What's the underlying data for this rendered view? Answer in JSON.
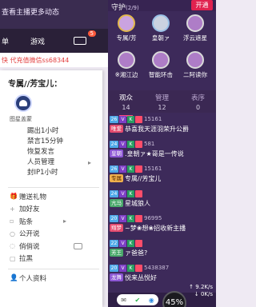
{
  "left_panel": {
    "follow_text": "查看主播更多动态",
    "tabs": [
      "单",
      "游戏"
    ],
    "tab_badge": "5",
    "ticker": "快 代充值微信ss68344"
  },
  "menu": {
    "title": "专属//芳宝儿：",
    "avatar_caption": "图星盖蒙",
    "ops": [
      {
        "label": "踢出1小时",
        "has_arrow": false
      },
      {
        "label": "禁言15分钟",
        "has_arrow": false
      },
      {
        "label": "恢复发言",
        "has_arrow": false
      },
      {
        "label": "人员管理",
        "has_arrow": true
      },
      {
        "label": "封IP1小时",
        "has_arrow": false
      }
    ],
    "items": [
      {
        "icon": "gift-icon",
        "glyph": "🎁",
        "label": "赠送礼物",
        "trail": "none"
      },
      {
        "icon": "plus-icon",
        "glyph": "+",
        "label": "加好友",
        "trail": "none"
      },
      {
        "icon": "sticker-icon",
        "glyph": "▫",
        "label": "贴条",
        "trail": "chevron"
      },
      {
        "icon": "chat-icon",
        "glyph": "○",
        "label": "公开说",
        "trail": "none"
      },
      {
        "icon": "whisper-icon",
        "glyph": "◌",
        "label": "俏俏说",
        "trail": "checkbox"
      },
      {
        "icon": "block-icon",
        "glyph": "▢",
        "label": "拉黑",
        "trail": "none"
      }
    ],
    "profile_label": "个人资料"
  },
  "guard": {
    "title": "守护",
    "count": "(2/9)",
    "open_button": "开通",
    "members": [
      {
        "name": "专属/芳",
        "style": "a"
      },
      {
        "name": "皇朝ァ",
        "style": "b"
      },
      {
        "name": "浮云遮星",
        "style": "c"
      },
      {
        "name": "※湘江边",
        "style": "c"
      },
      {
        "name": "智能环击",
        "style": "c"
      },
      {
        "name": "二阿读你",
        "style": "c"
      }
    ]
  },
  "viewer_tabs": [
    {
      "label": "观众",
      "count": "14",
      "active": true
    },
    {
      "label": "管理",
      "count": "12",
      "active": false
    },
    {
      "label": "表序",
      "count": "0",
      "active": false
    }
  ],
  "messages": [
    {
      "lv": "26",
      "uid": "15161",
      "tag": "唯爱",
      "tag_style": "red",
      "text": "恭喜我天涯羽荣升公爵"
    },
    {
      "lv": "24",
      "uid": "581",
      "tag": "皇朝",
      "tag_style": "purple",
      "text": ".皇朝ァ★哥是一传说"
    },
    {
      "lv": "26",
      "uid": "15161",
      "tag": "专属",
      "tag_style": "",
      "text": "专属//芳宝儿"
    },
    {
      "lv": "24",
      "uid": "",
      "tag": "亢马",
      "tag_style": "green",
      "text": "星城狼人"
    },
    {
      "lv": "20",
      "uid": "96995",
      "tag": "翔梦",
      "tag_style": "red",
      "text": "~梦❀想❀招收新主播"
    },
    {
      "lv": "22",
      "uid": "",
      "tag": "芳王",
      "tag_style": "green",
      "text": "ァ爸爸?"
    },
    {
      "lv": "20",
      "uid": "5438387",
      "tag": "龙舞",
      "tag_style": "purple",
      "text": "悦来丛悦好"
    }
  ],
  "status": {
    "speed_up": "↑ 9.2K/s",
    "speed_down": "↓ 0K/s",
    "percent": "45%"
  }
}
